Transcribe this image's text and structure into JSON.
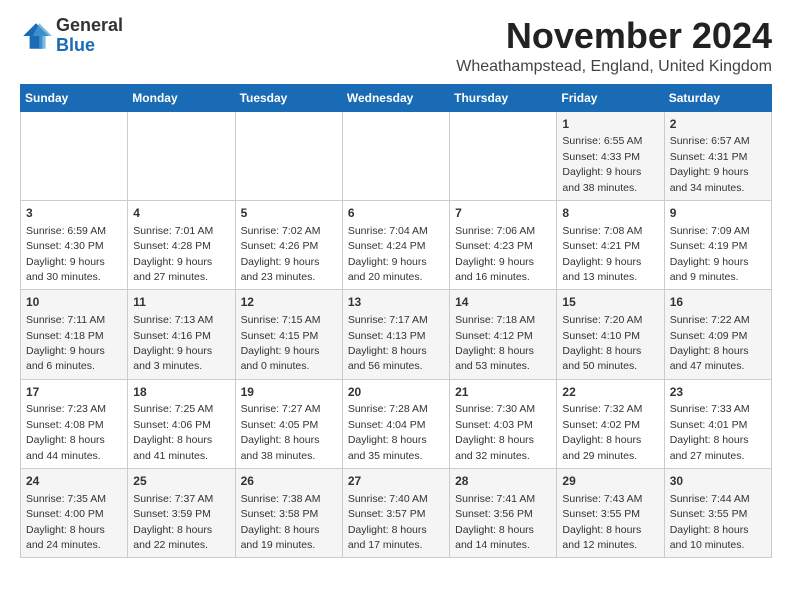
{
  "logo": {
    "general": "General",
    "blue": "Blue"
  },
  "title": {
    "month_year": "November 2024",
    "location": "Wheathampstead, England, United Kingdom"
  },
  "days_of_week": [
    "Sunday",
    "Monday",
    "Tuesday",
    "Wednesday",
    "Thursday",
    "Friday",
    "Saturday"
  ],
  "weeks": [
    [
      {
        "day": "",
        "info": ""
      },
      {
        "day": "",
        "info": ""
      },
      {
        "day": "",
        "info": ""
      },
      {
        "day": "",
        "info": ""
      },
      {
        "day": "",
        "info": ""
      },
      {
        "day": "1",
        "info": "Sunrise: 6:55 AM\nSunset: 4:33 PM\nDaylight: 9 hours\nand 38 minutes."
      },
      {
        "day": "2",
        "info": "Sunrise: 6:57 AM\nSunset: 4:31 PM\nDaylight: 9 hours\nand 34 minutes."
      }
    ],
    [
      {
        "day": "3",
        "info": "Sunrise: 6:59 AM\nSunset: 4:30 PM\nDaylight: 9 hours\nand 30 minutes."
      },
      {
        "day": "4",
        "info": "Sunrise: 7:01 AM\nSunset: 4:28 PM\nDaylight: 9 hours\nand 27 minutes."
      },
      {
        "day": "5",
        "info": "Sunrise: 7:02 AM\nSunset: 4:26 PM\nDaylight: 9 hours\nand 23 minutes."
      },
      {
        "day": "6",
        "info": "Sunrise: 7:04 AM\nSunset: 4:24 PM\nDaylight: 9 hours\nand 20 minutes."
      },
      {
        "day": "7",
        "info": "Sunrise: 7:06 AM\nSunset: 4:23 PM\nDaylight: 9 hours\nand 16 minutes."
      },
      {
        "day": "8",
        "info": "Sunrise: 7:08 AM\nSunset: 4:21 PM\nDaylight: 9 hours\nand 13 minutes."
      },
      {
        "day": "9",
        "info": "Sunrise: 7:09 AM\nSunset: 4:19 PM\nDaylight: 9 hours\nand 9 minutes."
      }
    ],
    [
      {
        "day": "10",
        "info": "Sunrise: 7:11 AM\nSunset: 4:18 PM\nDaylight: 9 hours\nand 6 minutes."
      },
      {
        "day": "11",
        "info": "Sunrise: 7:13 AM\nSunset: 4:16 PM\nDaylight: 9 hours\nand 3 minutes."
      },
      {
        "day": "12",
        "info": "Sunrise: 7:15 AM\nSunset: 4:15 PM\nDaylight: 9 hours\nand 0 minutes."
      },
      {
        "day": "13",
        "info": "Sunrise: 7:17 AM\nSunset: 4:13 PM\nDaylight: 8 hours\nand 56 minutes."
      },
      {
        "day": "14",
        "info": "Sunrise: 7:18 AM\nSunset: 4:12 PM\nDaylight: 8 hours\nand 53 minutes."
      },
      {
        "day": "15",
        "info": "Sunrise: 7:20 AM\nSunset: 4:10 PM\nDaylight: 8 hours\nand 50 minutes."
      },
      {
        "day": "16",
        "info": "Sunrise: 7:22 AM\nSunset: 4:09 PM\nDaylight: 8 hours\nand 47 minutes."
      }
    ],
    [
      {
        "day": "17",
        "info": "Sunrise: 7:23 AM\nSunset: 4:08 PM\nDaylight: 8 hours\nand 44 minutes."
      },
      {
        "day": "18",
        "info": "Sunrise: 7:25 AM\nSunset: 4:06 PM\nDaylight: 8 hours\nand 41 minutes."
      },
      {
        "day": "19",
        "info": "Sunrise: 7:27 AM\nSunset: 4:05 PM\nDaylight: 8 hours\nand 38 minutes."
      },
      {
        "day": "20",
        "info": "Sunrise: 7:28 AM\nSunset: 4:04 PM\nDaylight: 8 hours\nand 35 minutes."
      },
      {
        "day": "21",
        "info": "Sunrise: 7:30 AM\nSunset: 4:03 PM\nDaylight: 8 hours\nand 32 minutes."
      },
      {
        "day": "22",
        "info": "Sunrise: 7:32 AM\nSunset: 4:02 PM\nDaylight: 8 hours\nand 29 minutes."
      },
      {
        "day": "23",
        "info": "Sunrise: 7:33 AM\nSunset: 4:01 PM\nDaylight: 8 hours\nand 27 minutes."
      }
    ],
    [
      {
        "day": "24",
        "info": "Sunrise: 7:35 AM\nSunset: 4:00 PM\nDaylight: 8 hours\nand 24 minutes."
      },
      {
        "day": "25",
        "info": "Sunrise: 7:37 AM\nSunset: 3:59 PM\nDaylight: 8 hours\nand 22 minutes."
      },
      {
        "day": "26",
        "info": "Sunrise: 7:38 AM\nSunset: 3:58 PM\nDaylight: 8 hours\nand 19 minutes."
      },
      {
        "day": "27",
        "info": "Sunrise: 7:40 AM\nSunset: 3:57 PM\nDaylight: 8 hours\nand 17 minutes."
      },
      {
        "day": "28",
        "info": "Sunrise: 7:41 AM\nSunset: 3:56 PM\nDaylight: 8 hours\nand 14 minutes."
      },
      {
        "day": "29",
        "info": "Sunrise: 7:43 AM\nSunset: 3:55 PM\nDaylight: 8 hours\nand 12 minutes."
      },
      {
        "day": "30",
        "info": "Sunrise: 7:44 AM\nSunset: 3:55 PM\nDaylight: 8 hours\nand 10 minutes."
      }
    ]
  ]
}
